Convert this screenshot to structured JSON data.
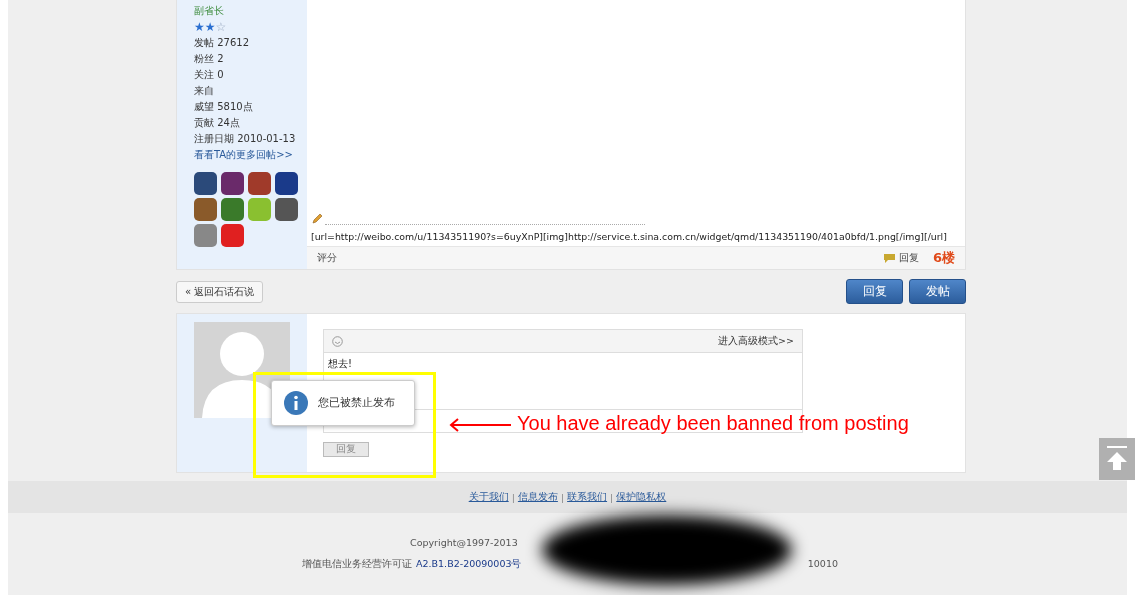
{
  "previous_post": {
    "author": {
      "rank": "副省长",
      "stars": 2,
      "stats": [
        {
          "label": "发帖",
          "value": "27612"
        },
        {
          "label": "粉丝",
          "value": "2"
        },
        {
          "label": "关注",
          "value": "0"
        },
        {
          "label": "来自"
        },
        {
          "label": "威望",
          "value": "5810点"
        },
        {
          "label": "贡献",
          "value": "24点"
        },
        {
          "label": "注册日期",
          "value": "2010-01-13"
        }
      ],
      "more_link": "看看TA的更多回帖>>"
    },
    "signature": "[url=http://weibo.com/u/1134351190?s=6uyXnP][img]http://service.t.sina.com.cn/widget/qmd/1134351190/401a0bfd/1.png[/img][/url]",
    "rate_label": "评分",
    "reply_label": "回复",
    "floor": "6楼"
  },
  "toolbar": {
    "back": "« 返回石话石说",
    "buttons": [
      "回复",
      "发帖"
    ]
  },
  "reply_form": {
    "advanced_link": "进入高级模式>>",
    "value": "想去!",
    "submit": "回复",
    "submit_disabled": true
  },
  "popup": {
    "message": "您已被禁止发布"
  },
  "annotation": {
    "text": "You have already been banned from posting"
  },
  "footer": {
    "links": [
      "关于我们",
      "信息发布",
      "联系我们",
      "保护隐私权"
    ],
    "separator": "|",
    "copyright": "Copyright@1997-2013",
    "license_label": "增值电信业务经营许可证",
    "license_number": "A2.B1.B2-20090003号",
    "hotline": "10010"
  }
}
